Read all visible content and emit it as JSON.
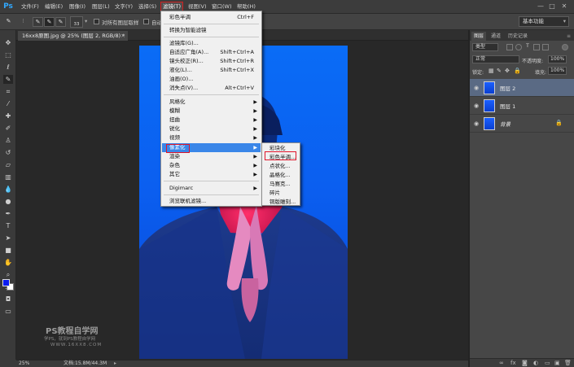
{
  "app": {
    "logo": "Ps"
  },
  "menubar": {
    "items": [
      "文件(F)",
      "编辑(E)",
      "图像(I)",
      "图层(L)",
      "文字(Y)",
      "选择(S)",
      "滤镜(T)",
      "视图(V)",
      "窗口(W)",
      "帮助(H)"
    ],
    "active_index": 6,
    "window_buttons": [
      "—",
      "□",
      "✕"
    ]
  },
  "options": {
    "brush_size": "33",
    "sample_all_layers": "对所有图层取样",
    "auto_enhance": "自动",
    "workspace": "基本功能"
  },
  "document": {
    "tab_title": "16xx8原图.jpg @ 25% (图层 2, RGB/8) *",
    "tab_close": "×",
    "zoom": "25%",
    "doc_size": "文档:15.8M/44.3M"
  },
  "filter_menu": {
    "items": [
      {
        "label": "彩色半调",
        "shortcut": "Ctrl+F"
      },
      {
        "label": "转换为智能滤镜",
        "shortcut": ""
      },
      {
        "label": "滤镜库(G)...",
        "shortcut": ""
      },
      {
        "label": "自适应广角(A)...",
        "shortcut": "Shift+Ctrl+A"
      },
      {
        "label": "镜头校正(R)...",
        "shortcut": "Shift+Ctrl+R"
      },
      {
        "label": "液化(L)...",
        "shortcut": "Shift+Ctrl+X"
      },
      {
        "label": "油画(O)...",
        "shortcut": ""
      },
      {
        "label": "消失点(V)...",
        "shortcut": "Alt+Ctrl+V"
      },
      {
        "label": "风格化",
        "shortcut": ""
      },
      {
        "label": "模糊",
        "shortcut": ""
      },
      {
        "label": "扭曲",
        "shortcut": ""
      },
      {
        "label": "锐化",
        "shortcut": ""
      },
      {
        "label": "视频",
        "shortcut": ""
      },
      {
        "label": "像素化",
        "shortcut": ""
      },
      {
        "label": "渲染",
        "shortcut": ""
      },
      {
        "label": "杂色",
        "shortcut": ""
      },
      {
        "label": "其它",
        "shortcut": ""
      },
      {
        "label": "Digimarc",
        "shortcut": ""
      },
      {
        "label": "浏览联机滤镜...",
        "shortcut": ""
      }
    ],
    "highlighted": "像素化"
  },
  "pixelate_submenu": {
    "items": [
      "彩块化",
      "彩色半调...",
      "点状化...",
      "晶格化...",
      "马赛克...",
      "碎片",
      "铜版雕刻..."
    ],
    "boxed": "彩色半调..."
  },
  "layers_panel": {
    "tabs": [
      "图层",
      "通道",
      "历史记录"
    ],
    "kind": "类型",
    "blend_mode": "正常",
    "opacity_label": "不透明度:",
    "opacity": "100%",
    "lock_label": "锁定:",
    "fill_label": "填充:",
    "fill": "100%",
    "layers": [
      {
        "name": "图层 2",
        "selected": true,
        "locked": false
      },
      {
        "name": "图层 1",
        "selected": false,
        "locked": false
      },
      {
        "name": "背景",
        "selected": false,
        "locked": true
      }
    ]
  },
  "watermark": {
    "title": "PS教程自学网",
    "line2": "学PS，就到PS教程自学网",
    "line3": "WWW.16XX8.COM"
  },
  "colors": {
    "accent_red": "#e0162b",
    "highlight_blue": "#3a86e8",
    "foreground": "#0b1cf0",
    "background": "#ffffff"
  }
}
